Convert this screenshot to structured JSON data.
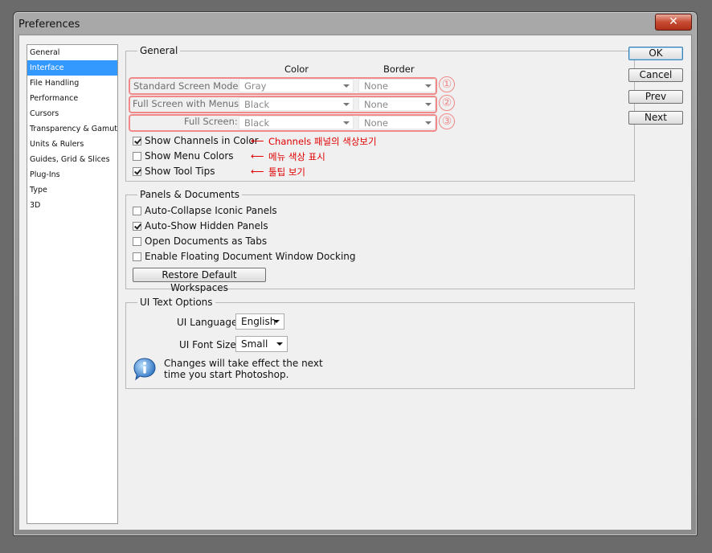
{
  "window": {
    "title": "Preferences",
    "close_label": "✕"
  },
  "sidebar": {
    "items": [
      {
        "label": "General"
      },
      {
        "label": "Interface"
      },
      {
        "label": "File Handling"
      },
      {
        "label": "Performance"
      },
      {
        "label": "Cursors"
      },
      {
        "label": "Transparency & Gamut"
      },
      {
        "label": "Units & Rulers"
      },
      {
        "label": "Guides, Grid & Slices"
      },
      {
        "label": "Plug-Ins"
      },
      {
        "label": "Type"
      },
      {
        "label": "3D"
      }
    ],
    "selected": "Interface",
    "selected_color": "#3399ff"
  },
  "general": {
    "legend": "General",
    "col_color": "Color",
    "col_border": "Border",
    "rows": [
      {
        "label": "Standard Screen Mode:",
        "color": "Gray",
        "border": "None",
        "marker": "①"
      },
      {
        "label": "Full Screen with Menus:",
        "color": "Black",
        "border": "None",
        "marker": "②"
      },
      {
        "label": "Full Screen:",
        "color": "Black",
        "border": "None",
        "marker": "③"
      }
    ],
    "checks": [
      {
        "label": "Show Channels in Color",
        "checked": true,
        "annotation": "Channels 패널의 색상보기"
      },
      {
        "label": "Show Menu Colors",
        "checked": false,
        "annotation": "메뉴 색상 표시"
      },
      {
        "label": "Show Tool Tips",
        "checked": true,
        "annotation": "툴팁 보기"
      }
    ],
    "annotation_arrow": "⟵",
    "highlight_color": "#f08a8a",
    "annotation_color": "#e00000"
  },
  "panels": {
    "legend": "Panels & Documents",
    "checks": [
      {
        "label": "Auto-Collapse Iconic Panels",
        "checked": false
      },
      {
        "label": "Auto-Show Hidden Panels",
        "checked": true
      },
      {
        "label": "Open Documents as Tabs",
        "checked": false
      },
      {
        "label": "Enable Floating Document Window Docking",
        "checked": false
      }
    ],
    "restore_label": "Restore Default Workspaces"
  },
  "ui_text": {
    "legend": "UI Text Options",
    "language_label": "UI Language:",
    "language_value": "English",
    "font_size_label": "UI Font Size:",
    "font_size_value": "Small",
    "notice": "Changes will take effect the next\ntime you start Photoshop.",
    "info_icon": "info-icon"
  },
  "buttons": {
    "ok": "OK",
    "cancel": "Cancel",
    "prev": "Prev",
    "next": "Next"
  }
}
